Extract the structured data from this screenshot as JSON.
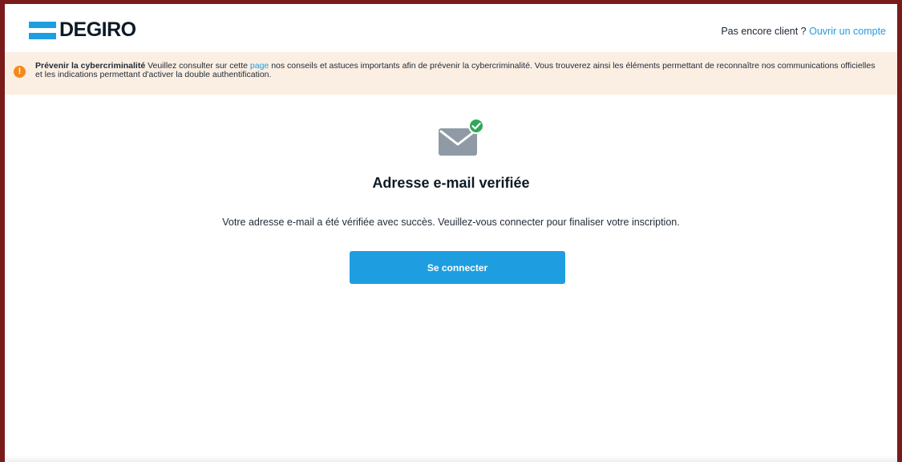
{
  "header": {
    "logo_text": "DEGIRO",
    "prompt_text": "Pas encore client ?",
    "open_account_link": "Ouvrir un compte"
  },
  "notice": {
    "icon": "warning-icon",
    "title": "Prévenir la cybercriminalité",
    "text_before_link": "Veuillez consulter sur cette",
    "link_text": "page",
    "text_after_link": "nos conseils et astuces importants afin de prévenir la cybercriminalité. Vous trouverez ainsi les éléments permettant de reconnaître nos communications officielles et les indications permettant d'activer la double authentification."
  },
  "main": {
    "icon": "email-verified-icon",
    "title": "Adresse e-mail verifiée",
    "message": "Votre adresse e-mail a été vérifiée avec succès. Veuillez-vous connecter pour finaliser votre inscription.",
    "login_button": "Se connecter"
  },
  "colors": {
    "accent": "#1e9ee0",
    "notice_bg": "#fbeee2",
    "warning": "#f28a1c",
    "success": "#2ea85a",
    "frame": "#7a1b1b"
  }
}
